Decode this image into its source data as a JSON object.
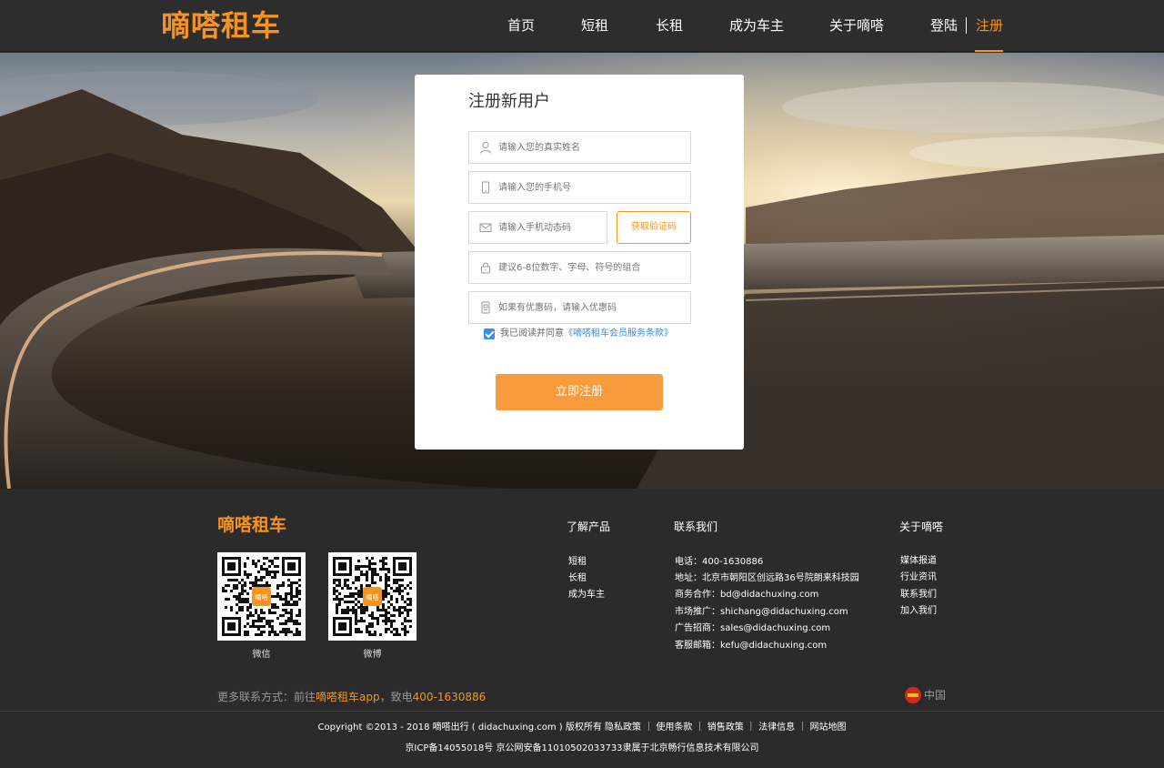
{
  "header": {
    "logo": "嘀嗒租车",
    "nav": [
      {
        "label": "首页"
      },
      {
        "label": "短租"
      },
      {
        "label": "长租"
      },
      {
        "label": "成为车主"
      },
      {
        "label": "关于嘀嗒"
      }
    ],
    "login": "登陆",
    "register": "注册"
  },
  "form": {
    "title": "注册新用户",
    "name_placeholder": "请输入您的真实姓名",
    "phone_placeholder": "请输入您的手机号",
    "code_placeholder": "请输入手机动态码",
    "get_code_label": "获取验证码",
    "password_placeholder": "建议6-8位数字、字母、符号的组合",
    "coupon_placeholder": "如果有优惠码，请输入优惠码",
    "agree_text": "我已阅读并同意",
    "agree_link": "《嘀嗒租车会员服务条款》",
    "submit_label": "立即注册"
  },
  "footer": {
    "logo": "嘀嗒租车",
    "qr": [
      {
        "caption": "微信",
        "badge": "嘀嗒"
      },
      {
        "caption": "微博",
        "badge": "嘀嗒"
      }
    ],
    "products": {
      "title": "了解产品",
      "items": [
        "短租",
        "长租",
        "成为车主"
      ]
    },
    "contact": {
      "title": "联系我们",
      "items": [
        "电话：400-1630886",
        "地址：北京市朝阳区创远路36号院朗来科技园",
        "商务合作：bd@didachuxing.com",
        "市场推广：shichang@didachuxing.com",
        "广告招商：sales@didachuxing.com",
        "客服邮箱：kefu@didachuxing.com"
      ]
    },
    "about": {
      "title": "关于嘀嗒",
      "items": [
        "媒体报道",
        "行业资讯",
        "联系我们",
        "加入我们"
      ]
    },
    "more_prefix": "更多联系方式：前往",
    "more_app": "嘀嗒租车app",
    "more_mid": "，致电",
    "more_phone": "400-1630886",
    "region": "中国",
    "copyright": "Copyright ©2013 - 2018 嘀嗒出行 ( didachuxing.com ) 版权所有 隐私政策 ｜ 使用条款 ｜ 销售政策 ｜ 法律信息 ｜ 网站地图",
    "icp": "京ICP备14055018号 京公网安备11010502033733隶属于北京畅行信息技术有限公司"
  },
  "colors": {
    "accent": "#f7941e",
    "button": "#f89b3d",
    "link": "#3d8ce8",
    "header_bg": "#2d2d2d",
    "footer_bg": "#2b2b2b"
  }
}
